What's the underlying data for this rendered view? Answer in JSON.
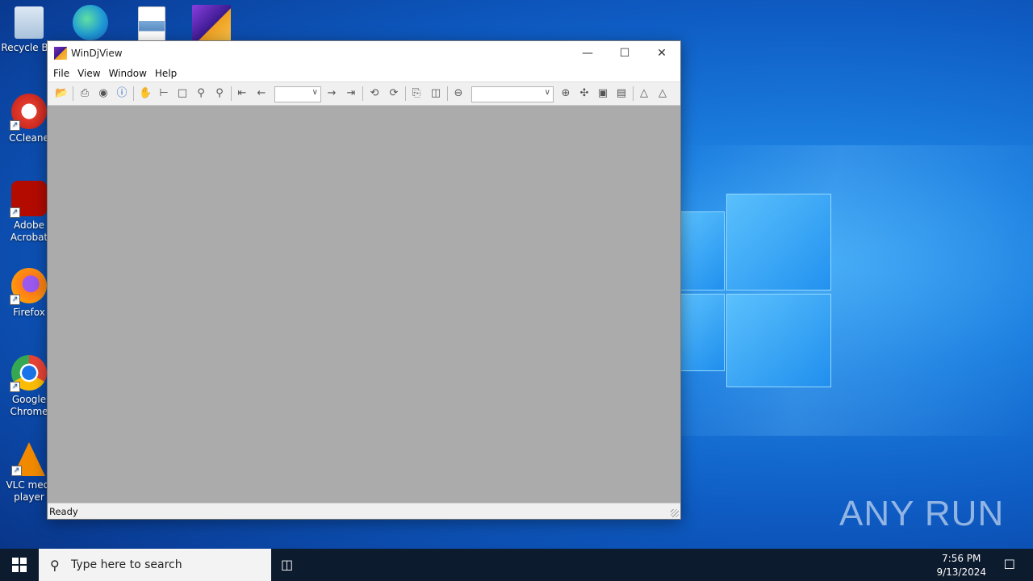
{
  "desktop": {
    "icons": [
      {
        "label": "Recycle Bin",
        "name": "recycle-bin"
      },
      {
        "label": "CCleaner",
        "name": "ccleaner"
      },
      {
        "label": "Adobe Acrobat",
        "name": "adobe-acrobat"
      },
      {
        "label": "Firefox",
        "name": "firefox"
      },
      {
        "label": "Google Chrome",
        "name": "google-chrome"
      },
      {
        "label": "VLC media player",
        "name": "vlc"
      }
    ],
    "watermark": "ANY RUN"
  },
  "window": {
    "title": "WinDjView",
    "menu": [
      "File",
      "View",
      "Window",
      "Help"
    ],
    "status": "Ready",
    "page_combo_value": "",
    "zoom_combo_value": ""
  },
  "taskbar": {
    "search_placeholder": "Type here to search",
    "time": "7:56 PM",
    "date": "9/13/2024"
  }
}
